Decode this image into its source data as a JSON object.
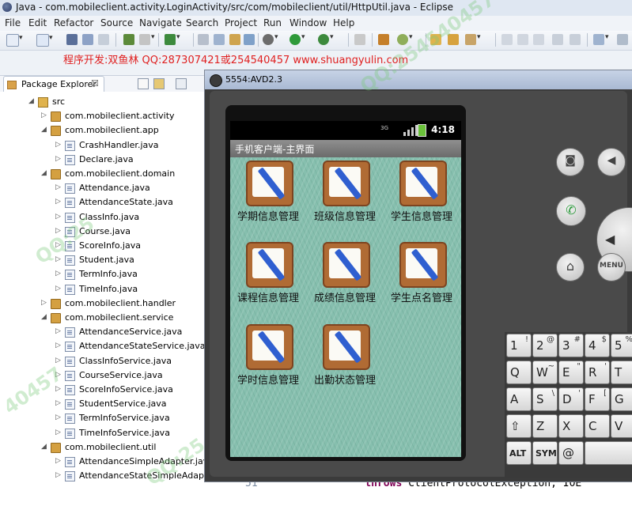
{
  "window": {
    "title": "Java - com.mobileclient.activity.LoginActivity/src/com/mobileclient/util/HttpUtil.java - Eclipse"
  },
  "menu": [
    "File",
    "Edit",
    "Refactor",
    "Source",
    "Navigate",
    "Search",
    "Project",
    "Run",
    "Window",
    "Help"
  ],
  "promo": "程序开发:双鱼林 QQ:287307421或254540457 www.shuangyulin.com",
  "package_explorer": {
    "title": "Package Explorer",
    "close": "☒",
    "tree": [
      {
        "label": "src",
        "icon": "folder-icon",
        "level": 0,
        "expanded": true
      },
      {
        "label": "com.mobileclient.activity",
        "icon": "package-icon",
        "level": 1,
        "expanded": false
      },
      {
        "label": "com.mobileclient.app",
        "icon": "package-icon",
        "level": 1,
        "expanded": true
      },
      {
        "label": "CrashHandler.java",
        "icon": "java-file-icon",
        "level": 2
      },
      {
        "label": "Declare.java",
        "icon": "java-file-icon",
        "level": 2
      },
      {
        "label": "com.mobileclient.domain",
        "icon": "package-icon",
        "level": 1,
        "expanded": true
      },
      {
        "label": "Attendance.java",
        "icon": "java-file-icon",
        "level": 2
      },
      {
        "label": "AttendanceState.java",
        "icon": "java-file-icon",
        "level": 2
      },
      {
        "label": "ClassInfo.java",
        "icon": "java-file-icon",
        "level": 2
      },
      {
        "label": "Course.java",
        "icon": "java-file-icon",
        "level": 2
      },
      {
        "label": "ScoreInfo.java",
        "icon": "java-file-icon",
        "level": 2
      },
      {
        "label": "Student.java",
        "icon": "java-file-icon",
        "level": 2
      },
      {
        "label": "TermInfo.java",
        "icon": "java-file-icon",
        "level": 2
      },
      {
        "label": "TimeInfo.java",
        "icon": "java-file-icon",
        "level": 2
      },
      {
        "label": "com.mobileclient.handler",
        "icon": "package-icon",
        "level": 1,
        "expanded": false
      },
      {
        "label": "com.mobileclient.service",
        "icon": "package-icon",
        "level": 1,
        "expanded": true
      },
      {
        "label": "AttendanceService.java",
        "icon": "java-file-icon",
        "level": 2
      },
      {
        "label": "AttendanceStateService.java",
        "icon": "java-file-icon",
        "level": 2
      },
      {
        "label": "ClassInfoService.java",
        "icon": "java-file-icon",
        "level": 2
      },
      {
        "label": "CourseService.java",
        "icon": "java-file-icon",
        "level": 2
      },
      {
        "label": "ScoreInfoService.java",
        "icon": "java-file-icon",
        "level": 2
      },
      {
        "label": "StudentService.java",
        "icon": "java-file-icon",
        "level": 2
      },
      {
        "label": "TermInfoService.java",
        "icon": "java-file-icon",
        "level": 2
      },
      {
        "label": "TimeInfoService.java",
        "icon": "java-file-icon",
        "level": 2
      },
      {
        "label": "com.mobileclient.util",
        "icon": "package-icon",
        "level": 1,
        "expanded": true
      },
      {
        "label": "AttendanceSimpleAdapter.jav",
        "icon": "java-file-icon",
        "level": 2
      },
      {
        "label": "AttendanceStateSimpleAdapte",
        "icon": "java-file-icon",
        "level": 2
      }
    ]
  },
  "editor": {
    "line_number": "51",
    "keyword": "throws",
    "code": " ClientProtocolException, IOE"
  },
  "emulator": {
    "title": "5554:AVD2.3",
    "status_time": "4:18",
    "network": "3G",
    "app_title": "手机客户端-主界面",
    "grid": [
      "学期信息管理",
      "班级信息管理",
      "学生信息管理",
      "课程信息管理",
      "成绩信息管理",
      "学生点名管理",
      "学时信息管理",
      "出勤状态管理"
    ],
    "controls": {
      "menu": "MENU"
    },
    "keyboard": {
      "rows": [
        [
          {
            "k": "1",
            "s": "!"
          },
          {
            "k": "2",
            "s": "@"
          },
          {
            "k": "3",
            "s": "#"
          },
          {
            "k": "4",
            "s": "$"
          },
          {
            "k": "5",
            "s": "%"
          }
        ],
        [
          {
            "k": "Q",
            "s": ""
          },
          {
            "k": "W",
            "s": "~"
          },
          {
            "k": "E",
            "s": "\""
          },
          {
            "k": "R",
            "s": "'"
          },
          {
            "k": "T",
            "s": ""
          }
        ],
        [
          {
            "k": "A",
            "s": ""
          },
          {
            "k": "S",
            "s": "\\"
          },
          {
            "k": "D",
            "s": "'"
          },
          {
            "k": "F",
            "s": "["
          },
          {
            "k": "G",
            "s": ""
          }
        ],
        [
          {
            "k": "⇧",
            "s": ""
          },
          {
            "k": "Z",
            "s": ""
          },
          {
            "k": "X",
            "s": ""
          },
          {
            "k": "C",
            "s": ""
          },
          {
            "k": "V",
            "s": ""
          }
        ],
        [
          {
            "k": "ALT",
            "s": ""
          },
          {
            "k": "SYM",
            "s": ""
          },
          {
            "k": "@",
            "s": ""
          },
          {
            "k": "",
            "s": ""
          },
          {
            "k": "",
            "s": ""
          }
        ]
      ]
    }
  },
  "colors": {
    "promo": "#e02020",
    "keyword": "#7f0055",
    "watermark": "#78c878"
  }
}
